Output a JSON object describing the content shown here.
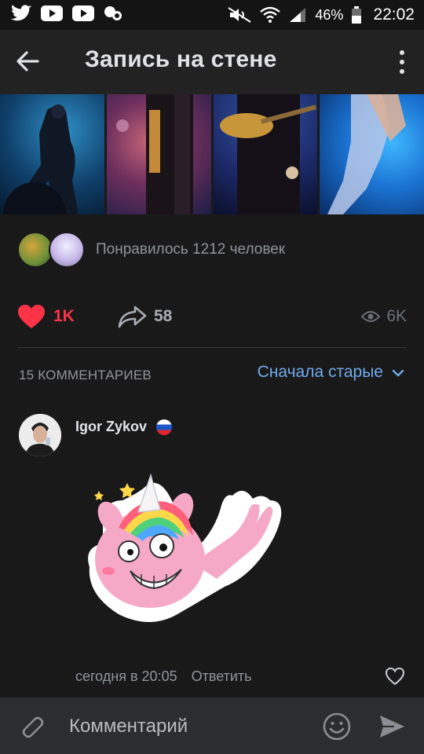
{
  "status_bar": {
    "battery": "46%",
    "time": "22:02"
  },
  "header": {
    "title": "Запись на стене"
  },
  "likes": {
    "text": "Понравилось 1212 человек"
  },
  "actions": {
    "likes": "1K",
    "shares": "58",
    "views": "6K"
  },
  "comments": {
    "count_label": "15 КОММЕНТАРИЕВ",
    "sort_label": "Сначала старые",
    "items": [
      {
        "author": "Igor Zykov",
        "time": "сегодня в 20:05",
        "reply": "Ответить"
      }
    ]
  },
  "composer": {
    "placeholder": "Комментарий"
  },
  "colors": {
    "background": "#19191a",
    "accent_blue": "#71aaeb",
    "like_red": "#ff3347",
    "muted": "#909499"
  }
}
